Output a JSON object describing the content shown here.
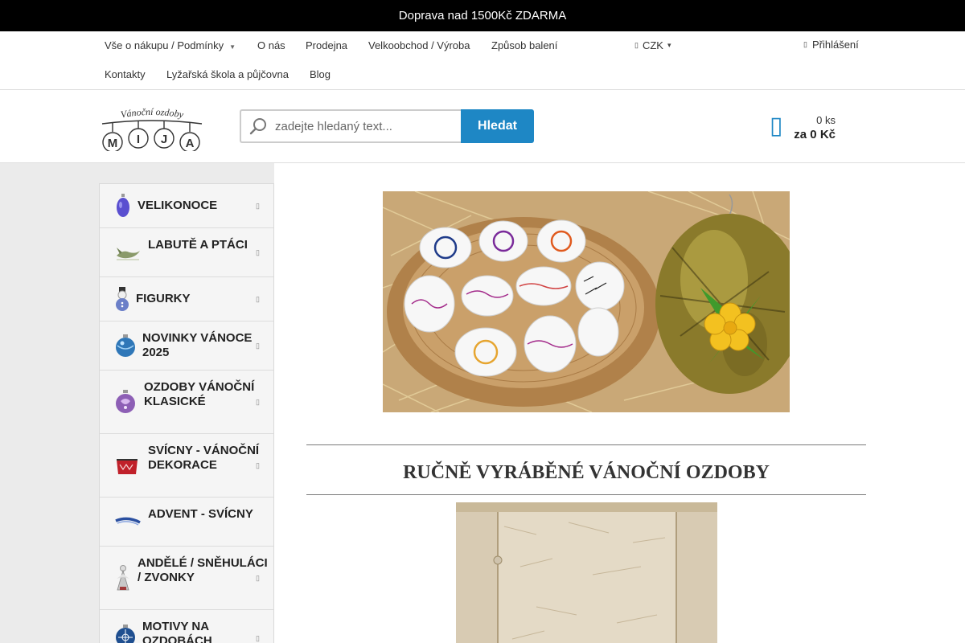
{
  "announcement": "Doprava nad 1500Kč ZDARMA",
  "nav": {
    "items": [
      {
        "label": "Vše o nákupu / Podmínky",
        "has_caret": true
      },
      {
        "label": "O nás"
      },
      {
        "label": "Prodejna"
      },
      {
        "label": "Velkoobchod / Výroba"
      },
      {
        "label": "Způsob balení"
      },
      {
        "label": "Kontakty"
      },
      {
        "label": "Lyžařská škola a půjčovna"
      },
      {
        "label": "Blog"
      }
    ],
    "currency": "CZK",
    "login": "Přihlášení"
  },
  "logo": {
    "arc_text": "Vánoční ozdoby",
    "letters": [
      "M",
      "I",
      "J",
      "A"
    ]
  },
  "search": {
    "placeholder": "zadejte hledaný text...",
    "button": "Hledat"
  },
  "cart": {
    "count": "0 ks",
    "price": "za 0 Kč"
  },
  "categories": [
    {
      "label": "Velikonoce",
      "icon": "easter-egg-icon",
      "has_arrow": true
    },
    {
      "label": "Labutě a ptáci",
      "icon": "bird-icon",
      "has_arrow": true
    },
    {
      "label": "Figurky",
      "icon": "snowman-figure-icon",
      "has_arrow": true
    },
    {
      "label": "Novinky Vánoce 2025",
      "icon": "blue-bauble-icon",
      "has_arrow": true
    },
    {
      "label": "Ozdoby vánoční klasické",
      "icon": "purple-bauble-icon",
      "has_arrow": true
    },
    {
      "label": "Svícny - vánoční dekorace",
      "icon": "candle-holder-icon",
      "has_arrow": true
    },
    {
      "label": "Advent - svícny",
      "icon": "advent-candle-icon",
      "has_arrow": false
    },
    {
      "label": "Andělé / sněhuláci / zvonky",
      "icon": "angel-icon",
      "has_arrow": true
    },
    {
      "label": "Motivy na ozdobách",
      "icon": "motif-bauble-icon",
      "has_arrow": true
    }
  ],
  "main": {
    "heading": "RUČNĚ VYRÁBĚNÉ VÁNOČNÍ OZDOBY"
  },
  "colors": {
    "accent": "#1e87c5",
    "topbar": "#000000",
    "page_bg": "#ebebeb"
  }
}
